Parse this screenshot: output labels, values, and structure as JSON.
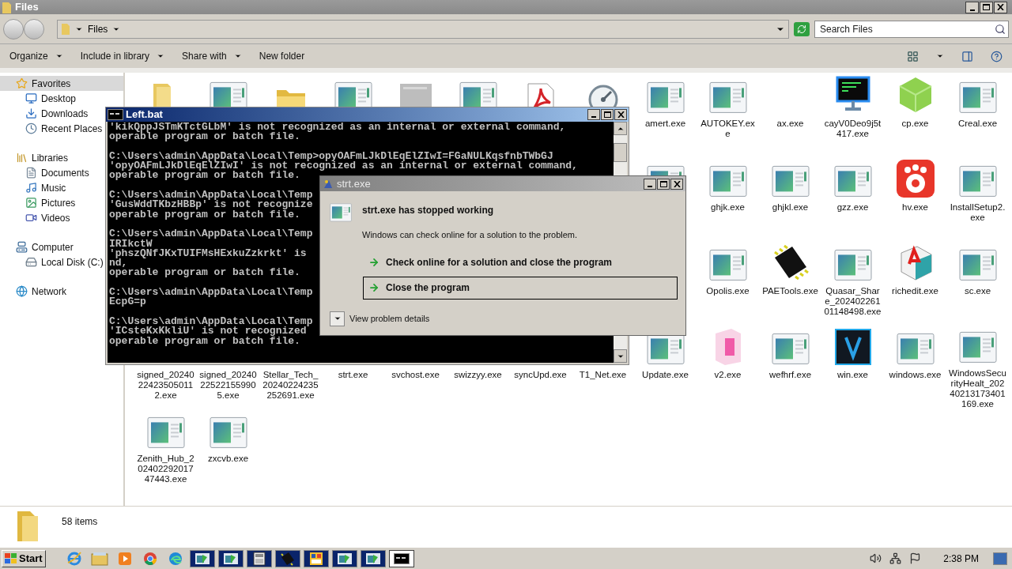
{
  "explorer": {
    "title": "Files",
    "address": {
      "path": "Files"
    },
    "search": {
      "placeholder": "Search Files"
    },
    "toolbar": [
      {
        "label": "Organize",
        "dropdown": true
      },
      {
        "label": "Include in library",
        "dropdown": true
      },
      {
        "label": "Share with",
        "dropdown": true
      },
      {
        "label": "New folder",
        "dropdown": false
      }
    ],
    "sidebar": [
      {
        "label": "Favorites",
        "kind": "star",
        "selected": true,
        "children": [
          {
            "label": "Desktop",
            "kind": "desktop",
            "selected": false
          },
          {
            "label": "Downloads",
            "kind": "downloads",
            "selected": false
          },
          {
            "label": "Recent Places",
            "kind": "recent",
            "selected": false
          }
        ]
      },
      {
        "label": "Libraries",
        "kind": "libraries",
        "selected": false,
        "children": [
          {
            "label": "Documents",
            "kind": "documents",
            "selected": false
          },
          {
            "label": "Music",
            "kind": "music",
            "selected": false
          },
          {
            "label": "Pictures",
            "kind": "pictures",
            "selected": false
          },
          {
            "label": "Videos",
            "kind": "videos",
            "selected": false
          }
        ]
      },
      {
        "label": "Computer",
        "kind": "computer",
        "selected": false,
        "children": [
          {
            "label": "Local Disk (C:)",
            "kind": "disk",
            "selected": false
          }
        ]
      },
      {
        "label": "Network",
        "kind": "network",
        "selected": false
      }
    ],
    "files": [
      [
        {
          "kind": "folder-tall"
        },
        {
          "kind": "app"
        },
        {
          "kind": "folder"
        },
        {
          "kind": "app"
        },
        {
          "kind": "blank"
        },
        {
          "kind": "app"
        },
        {
          "kind": "pdf"
        },
        {
          "kind": "gauge"
        },
        {
          "kind": "app",
          "label": "amert.exe"
        },
        {
          "kind": "app",
          "label": "AUTOKEY.exe"
        },
        {
          "kind": "none",
          "label": "ax.exe"
        },
        {
          "kind": "terminal",
          "label": "cayV0Deo9j5t417.exe"
        },
        {
          "kind": "cube",
          "label": "cp.exe"
        },
        {
          "kind": "app",
          "label": "Creal.exe"
        }
      ],
      [
        {
          "kind": "none"
        },
        {
          "kind": "none"
        },
        {
          "kind": "none"
        },
        {
          "kind": "none"
        },
        {
          "kind": "none"
        },
        {
          "kind": "none"
        },
        {
          "kind": "none"
        },
        {
          "kind": "none"
        },
        {
          "kind": "app"
        },
        {
          "kind": "app",
          "label": "ghjk.exe"
        },
        {
          "kind": "app",
          "label": "ghjkl.exe"
        },
        {
          "kind": "app",
          "label": "gzz.exe"
        },
        {
          "kind": "paw",
          "label": "hv.exe"
        },
        {
          "kind": "app",
          "label": "InstallSetup2.exe"
        }
      ],
      [
        {
          "kind": "none"
        },
        {
          "kind": "none"
        },
        {
          "kind": "none"
        },
        {
          "kind": "none"
        },
        {
          "kind": "none"
        },
        {
          "kind": "none"
        },
        {
          "kind": "none"
        },
        {
          "kind": "none"
        },
        {
          "kind": "none"
        },
        {
          "kind": "app",
          "label": "Opolis.exe"
        },
        {
          "kind": "chip",
          "label": "PAETools.exe"
        },
        {
          "kind": "app",
          "label": "Quasar_Share_20240226101148498.exe"
        },
        {
          "kind": "dice",
          "label": "richedit.exe"
        },
        {
          "kind": "app",
          "label": "sc.exe"
        }
      ],
      [
        {
          "kind": "none",
          "label": "signed_20240224235050112.exe"
        },
        {
          "kind": "none",
          "label": "signed_20240225221559905.exe"
        },
        {
          "kind": "none",
          "label": "Stellar_Tech_20240224235252691.exe"
        },
        {
          "kind": "none",
          "label": "strt.exe"
        },
        {
          "kind": "none",
          "label": "svchost.exe"
        },
        {
          "kind": "none",
          "label": "swizzyy.exe"
        },
        {
          "kind": "none",
          "label": "syncUpd.exe"
        },
        {
          "kind": "none",
          "label": "T1_Net.exe"
        },
        {
          "kind": "app",
          "label": "Update.exe"
        },
        {
          "kind": "pinkbox",
          "label": "v2.exe"
        },
        {
          "kind": "app",
          "label": "wefhrf.exe"
        },
        {
          "kind": "vlogo",
          "label": "win.exe"
        },
        {
          "kind": "app",
          "label": "windows.exe"
        },
        {
          "kind": "app",
          "label": "WindowsSecurityHealt_20240213173401169.exe"
        }
      ],
      [
        {
          "kind": "app",
          "label": "Zenith_Hub_20240229201747443.exe"
        },
        {
          "kind": "app",
          "label": "zxcvb.exe"
        }
      ]
    ],
    "details": {
      "count": "58 items"
    }
  },
  "console": {
    "title": "Left.bat",
    "blocks": [
      [
        "'kikQppJSTmKTctGLbM' is not recognized as an internal or external command,",
        "operable program or batch file."
      ],
      [
        "C:\\Users\\admin\\AppData\\Local\\Temp>opyOAFmLJkDlEqElZIwI=FGaNULKqsfnbTWbGJ",
        "'opyOAFmLJkDlEqElZIwI' is not recognized as an internal or external command,",
        "operable program or batch file."
      ],
      [
        "C:\\Users\\admin\\AppData\\Local\\Temp",
        "'GusWddTKbzHBBp' is not recognize",
        "operable program or batch file."
      ],
      [
        "C:\\Users\\admin\\AppData\\Local\\Temp",
        "IRIkctW",
        "'phszQNfJKxTUIFMsHExkuZzkrkt' is",
        "nd,",
        "operable program or batch file."
      ],
      [
        "C:\\Users\\admin\\AppData\\Local\\Temp",
        "EcpG=p"
      ],
      [
        "C:\\Users\\admin\\AppData\\Local\\Temp",
        "'ICsteKxKkliU' is not recognized",
        "operable program or batch file."
      ]
    ]
  },
  "error_dialog": {
    "title": "strt.exe",
    "heading": "strt.exe has stopped working",
    "message": "Windows can check online for a solution to the problem.",
    "options": [
      {
        "label": "Check online for a solution and close the program",
        "selected": false
      },
      {
        "label": "Close the program",
        "selected": true
      }
    ],
    "details_toggle": "View problem details"
  },
  "taskbar": {
    "start": "Start",
    "items": [
      {
        "kind": "ie",
        "selected": false
      },
      {
        "kind": "files",
        "selected": false
      },
      {
        "kind": "player",
        "selected": false
      },
      {
        "kind": "chrome",
        "selected": false
      },
      {
        "kind": "edge",
        "selected": false
      },
      {
        "kind": "setup",
        "selected": false
      },
      {
        "kind": "setup",
        "selected": false
      },
      {
        "kind": "calc",
        "selected": false
      },
      {
        "kind": "chip",
        "selected": false
      },
      {
        "kind": "panel",
        "selected": false
      },
      {
        "kind": "setup",
        "selected": false
      },
      {
        "kind": "setup",
        "selected": false
      },
      {
        "kind": "console",
        "selected": true
      }
    ],
    "clock": "2:38 PM"
  }
}
